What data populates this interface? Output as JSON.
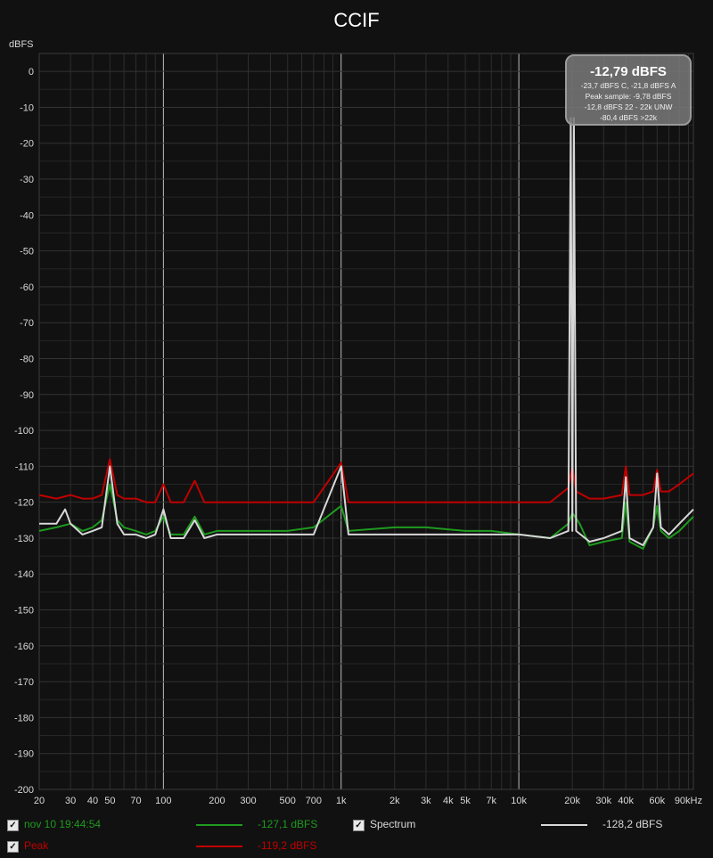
{
  "chart_data": {
    "type": "line",
    "title": "CCIF",
    "ylabel": "dBFS",
    "x_scale": "log",
    "xlim": [
      20,
      96000
    ],
    "ylim": [
      -200,
      5
    ],
    "x_ticks": [
      {
        "v": 20,
        "label": "20"
      },
      {
        "v": 30,
        "label": "30"
      },
      {
        "v": 40,
        "label": "40"
      },
      {
        "v": 50,
        "label": "50"
      },
      {
        "v": 70,
        "label": "70"
      },
      {
        "v": 100,
        "label": "100"
      },
      {
        "v": 200,
        "label": "200"
      },
      {
        "v": 300,
        "label": "300"
      },
      {
        "v": 500,
        "label": "500"
      },
      {
        "v": 700,
        "label": "700"
      },
      {
        "v": 1000,
        "label": "1k"
      },
      {
        "v": 2000,
        "label": "2k"
      },
      {
        "v": 3000,
        "label": "3k"
      },
      {
        "v": 4000,
        "label": "4k"
      },
      {
        "v": 5000,
        "label": "5k"
      },
      {
        "v": 7000,
        "label": "7k"
      },
      {
        "v": 10000,
        "label": "10k"
      },
      {
        "v": 20000,
        "label": "20k"
      },
      {
        "v": 30000,
        "label": "30k"
      },
      {
        "v": 40000,
        "label": "40k"
      },
      {
        "v": 60000,
        "label": "60k"
      },
      {
        "v": 90000,
        "label": "90kHz"
      }
    ],
    "y_ticks": [
      0,
      -10,
      -20,
      -30,
      -40,
      -50,
      -60,
      -70,
      -80,
      -90,
      -100,
      -110,
      -120,
      -130,
      -140,
      -150,
      -160,
      -170,
      -180,
      -190,
      -200
    ],
    "grid": true,
    "series": [
      {
        "name": "nov 10 19:44:54",
        "color": "#1f9a1f",
        "points": [
          [
            20,
            -128
          ],
          [
            25,
            -127
          ],
          [
            30,
            -126
          ],
          [
            35,
            -128
          ],
          [
            40,
            -127
          ],
          [
            45,
            -125
          ],
          [
            50,
            -115
          ],
          [
            55,
            -125
          ],
          [
            60,
            -127
          ],
          [
            70,
            -128
          ],
          [
            80,
            -129
          ],
          [
            90,
            -128
          ],
          [
            100,
            -124
          ],
          [
            110,
            -129
          ],
          [
            130,
            -129
          ],
          [
            150,
            -124
          ],
          [
            170,
            -129
          ],
          [
            200,
            -128
          ],
          [
            300,
            -128
          ],
          [
            500,
            -128
          ],
          [
            700,
            -127
          ],
          [
            1000,
            -121
          ],
          [
            1100,
            -128
          ],
          [
            2000,
            -127
          ],
          [
            3000,
            -127
          ],
          [
            5000,
            -128
          ],
          [
            7000,
            -128
          ],
          [
            10000,
            -129
          ],
          [
            15000,
            -130
          ],
          [
            19000,
            -126
          ],
          [
            20000,
            -123
          ],
          [
            22000,
            -126
          ],
          [
            25000,
            -132
          ],
          [
            30000,
            -131
          ],
          [
            38000,
            -130
          ],
          [
            40000,
            -120
          ],
          [
            42000,
            -131
          ],
          [
            50000,
            -133
          ],
          [
            57000,
            -127
          ],
          [
            60000,
            -121
          ],
          [
            63000,
            -128
          ],
          [
            70000,
            -130
          ],
          [
            80000,
            -128
          ],
          [
            96000,
            -124
          ]
        ]
      },
      {
        "name": "Peak",
        "color": "#c00000",
        "points": [
          [
            20,
            -118
          ],
          [
            25,
            -119
          ],
          [
            30,
            -118
          ],
          [
            35,
            -119
          ],
          [
            40,
            -119
          ],
          [
            45,
            -118
          ],
          [
            50,
            -108
          ],
          [
            55,
            -118
          ],
          [
            60,
            -119
          ],
          [
            70,
            -119
          ],
          [
            80,
            -120
          ],
          [
            90,
            -120
          ],
          [
            100,
            -115
          ],
          [
            110,
            -120
          ],
          [
            130,
            -120
          ],
          [
            150,
            -114
          ],
          [
            170,
            -120
          ],
          [
            200,
            -120
          ],
          [
            300,
            -120
          ],
          [
            500,
            -120
          ],
          [
            700,
            -120
          ],
          [
            1000,
            -109
          ],
          [
            1100,
            -120
          ],
          [
            2000,
            -120
          ],
          [
            3000,
            -120
          ],
          [
            5000,
            -120
          ],
          [
            7000,
            -120
          ],
          [
            10000,
            -120
          ],
          [
            15000,
            -120
          ],
          [
            19000,
            -116
          ],
          [
            20000,
            -110
          ],
          [
            21000,
            -117
          ],
          [
            25000,
            -119
          ],
          [
            30000,
            -119
          ],
          [
            38000,
            -118
          ],
          [
            40000,
            -110
          ],
          [
            42000,
            -118
          ],
          [
            50000,
            -118
          ],
          [
            57000,
            -117
          ],
          [
            60000,
            -111
          ],
          [
            63000,
            -117
          ],
          [
            70000,
            -117
          ],
          [
            80000,
            -115
          ],
          [
            96000,
            -112
          ]
        ]
      },
      {
        "name": "Spectrum",
        "color": "#d8d8d8",
        "points": [
          [
            20,
            -126
          ],
          [
            25,
            -126
          ],
          [
            28,
            -122
          ],
          [
            30,
            -126
          ],
          [
            35,
            -129
          ],
          [
            40,
            -128
          ],
          [
            45,
            -127
          ],
          [
            50,
            -110
          ],
          [
            55,
            -126
          ],
          [
            60,
            -129
          ],
          [
            70,
            -129
          ],
          [
            80,
            -130
          ],
          [
            90,
            -129
          ],
          [
            100,
            -122
          ],
          [
            110,
            -130
          ],
          [
            130,
            -130
          ],
          [
            150,
            -125
          ],
          [
            170,
            -130
          ],
          [
            200,
            -129
          ],
          [
            300,
            -129
          ],
          [
            500,
            -129
          ],
          [
            700,
            -129
          ],
          [
            1000,
            -110
          ],
          [
            1100,
            -129
          ],
          [
            2000,
            -129
          ],
          [
            3000,
            -129
          ],
          [
            5000,
            -129
          ],
          [
            7000,
            -129
          ],
          [
            10000,
            -129
          ],
          [
            15000,
            -130
          ],
          [
            19000,
            -128
          ],
          [
            19600,
            -13
          ],
          [
            20000,
            -128
          ],
          [
            20400,
            -13
          ],
          [
            21000,
            -128
          ],
          [
            25000,
            -131
          ],
          [
            30000,
            -130
          ],
          [
            38000,
            -128
          ],
          [
            40000,
            -113
          ],
          [
            42000,
            -130
          ],
          [
            50000,
            -132
          ],
          [
            57000,
            -127
          ],
          [
            60000,
            -112
          ],
          [
            63000,
            -127
          ],
          [
            70000,
            -129
          ],
          [
            80000,
            -126
          ],
          [
            96000,
            -122
          ]
        ]
      }
    ]
  },
  "readout": {
    "main": "-12,79 dBFS",
    "lines": [
      "-23,7 dBFS C, -21,8 dBFS A",
      "Peak sample: -9,78 dBFS",
      "-12,8 dBFS 22 - 22k UNW",
      "-80,4 dBFS >22k"
    ]
  },
  "legend": {
    "items": [
      {
        "label": "nov 10 19:44:54",
        "value": "-127,1 dBFS",
        "color": "#1f9a1f",
        "checked": "✓"
      },
      {
        "label": "Spectrum",
        "value": "-128,2 dBFS",
        "color": "#d8d8d8",
        "checked": "✓"
      },
      {
        "label": "Peak",
        "value": "-119,2 dBFS",
        "color": "#c00000",
        "checked": "✓"
      }
    ]
  }
}
